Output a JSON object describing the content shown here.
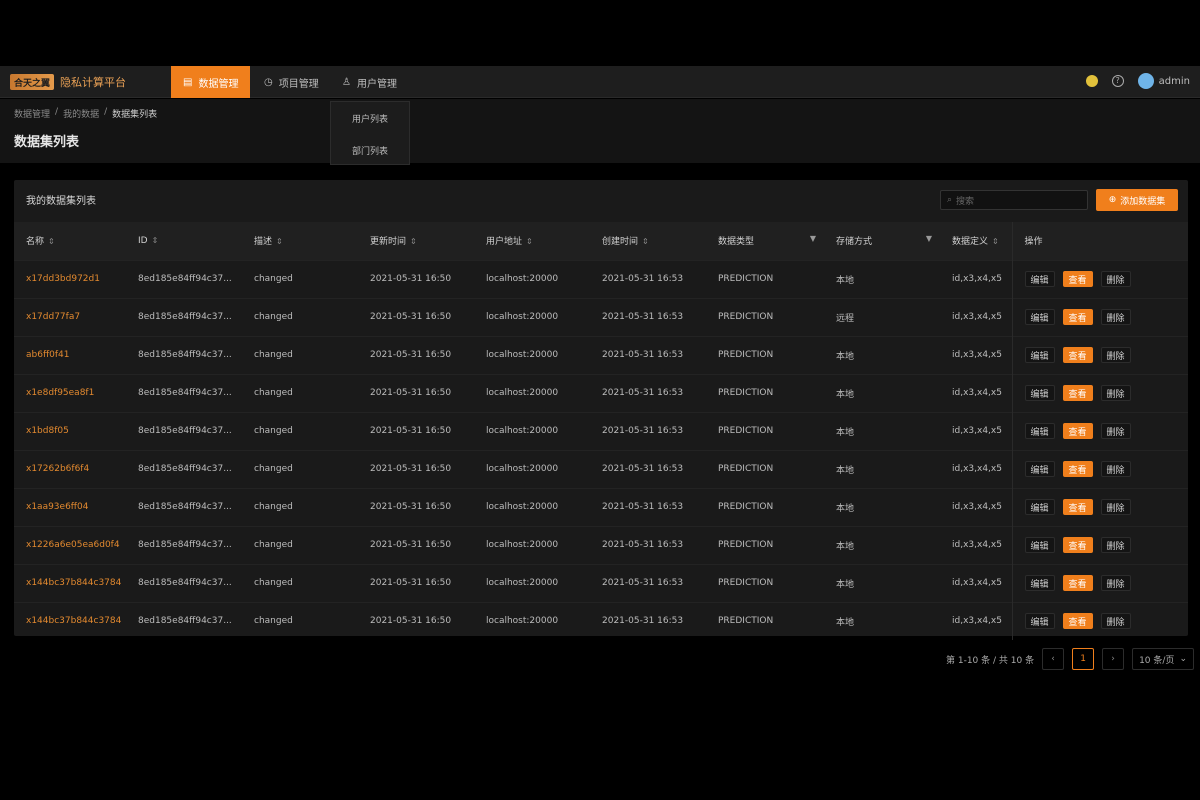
{
  "header": {
    "logo_mark": "合天之翼",
    "logo_name": "隐私计算平台",
    "nav": [
      {
        "label": "数据管理",
        "icon": "database-icon",
        "glyph": "▤"
      },
      {
        "label": "项目管理",
        "icon": "project-icon",
        "glyph": "◷"
      },
      {
        "label": "用户管理",
        "icon": "user-icon",
        "glyph": "♙"
      }
    ],
    "user": "admin"
  },
  "dropdown": {
    "items": [
      "用户列表",
      "部门列表"
    ]
  },
  "breadcrumb": [
    "数据管理",
    "我的数据",
    "数据集列表"
  ],
  "page_title": "数据集列表",
  "card": {
    "title": "我的数据集列表",
    "search_placeholder": "搜索",
    "add_label": "添加数据集"
  },
  "table": {
    "columns": [
      "名称",
      "ID",
      "描述",
      "更新时间",
      "用户地址",
      "创建时间",
      "数据类型",
      "存储方式",
      "数据定义",
      "操作"
    ],
    "rows": [
      {
        "name": "x17dd3bd972d1",
        "id": "8ed185e84ff94c37...",
        "desc": "changed",
        "updated": "2021-05-31 16:50",
        "address": "localhost:20000",
        "created": "2021-05-31 16:53",
        "type": "PREDICTION",
        "storage": "本地",
        "schema": "id,x3,x4,x5"
      },
      {
        "name": "x17dd77fa7",
        "id": "8ed185e84ff94c37...",
        "desc": "changed",
        "updated": "2021-05-31 16:50",
        "address": "localhost:20000",
        "created": "2021-05-31 16:53",
        "type": "PREDICTION",
        "storage": "远程",
        "schema": "id,x3,x4,x5"
      },
      {
        "name": "ab6ff0f41",
        "id": "8ed185e84ff94c37...",
        "desc": "changed",
        "updated": "2021-05-31 16:50",
        "address": "localhost:20000",
        "created": "2021-05-31 16:53",
        "type": "PREDICTION",
        "storage": "本地",
        "schema": "id,x3,x4,x5"
      },
      {
        "name": "x1e8df95ea8f1",
        "id": "8ed185e84ff94c37...",
        "desc": "changed",
        "updated": "2021-05-31 16:50",
        "address": "localhost:20000",
        "created": "2021-05-31 16:53",
        "type": "PREDICTION",
        "storage": "本地",
        "schema": "id,x3,x4,x5"
      },
      {
        "name": "x1bd8f05",
        "id": "8ed185e84ff94c37...",
        "desc": "changed",
        "updated": "2021-05-31 16:50",
        "address": "localhost:20000",
        "created": "2021-05-31 16:53",
        "type": "PREDICTION",
        "storage": "本地",
        "schema": "id,x3,x4,x5"
      },
      {
        "name": "x17262b6f6f4",
        "id": "8ed185e84ff94c37...",
        "desc": "changed",
        "updated": "2021-05-31 16:50",
        "address": "localhost:20000",
        "created": "2021-05-31 16:53",
        "type": "PREDICTION",
        "storage": "本地",
        "schema": "id,x3,x4,x5"
      },
      {
        "name": "x1aa93e6ff04",
        "id": "8ed185e84ff94c37...",
        "desc": "changed",
        "updated": "2021-05-31 16:50",
        "address": "localhost:20000",
        "created": "2021-05-31 16:53",
        "type": "PREDICTION",
        "storage": "本地",
        "schema": "id,x3,x4,x5"
      },
      {
        "name": "x1226a6e05ea6d0f4",
        "id": "8ed185e84ff94c37...",
        "desc": "changed",
        "updated": "2021-05-31 16:50",
        "address": "localhost:20000",
        "created": "2021-05-31 16:53",
        "type": "PREDICTION",
        "storage": "本地",
        "schema": "id,x3,x4,x5"
      },
      {
        "name": "x144bc37b844c3784",
        "id": "8ed185e84ff94c37...",
        "desc": "changed",
        "updated": "2021-05-31 16:50",
        "address": "localhost:20000",
        "created": "2021-05-31 16:53",
        "type": "PREDICTION",
        "storage": "本地",
        "schema": "id,x3,x4,x5"
      },
      {
        "name": "x144bc37b844c3784",
        "id": "8ed185e84ff94c37...",
        "desc": "changed",
        "updated": "2021-05-31 16:50",
        "address": "localhost:20000",
        "created": "2021-05-31 16:53",
        "type": "PREDICTION",
        "storage": "本地",
        "schema": "id,x3,x4,x5"
      }
    ],
    "ops": [
      "编辑",
      "查看",
      "删除"
    ]
  },
  "pagination": {
    "summary": "第 1-10 条 / 共 10 条",
    "prev": "‹",
    "current": "1",
    "next": "›",
    "page_size": "10 条/页"
  },
  "colors": {
    "accent": "#f07f1c",
    "link": "#e2892f",
    "bg": "#000000",
    "surface": "#1a1a1a"
  }
}
